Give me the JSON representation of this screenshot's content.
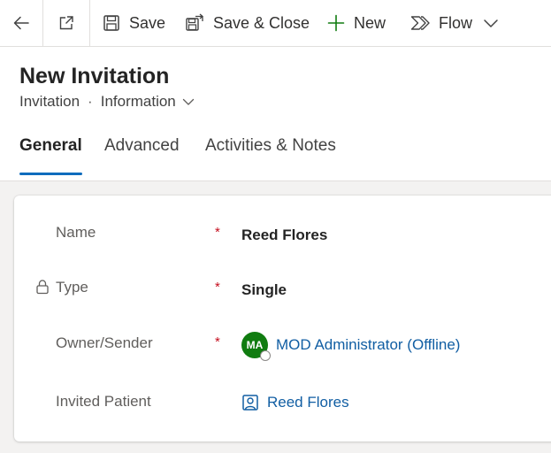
{
  "toolbar": {
    "save_label": "Save",
    "save_close_label": "Save & Close",
    "new_label": "New",
    "flow_label": "Flow"
  },
  "header": {
    "title": "New Invitation",
    "entity": "Invitation",
    "separator": "·",
    "form_name": "Information"
  },
  "tabs": [
    {
      "label": "General",
      "active": true
    },
    {
      "label": "Advanced",
      "active": false
    },
    {
      "label": "Activities & Notes",
      "active": false
    }
  ],
  "fields": {
    "name": {
      "label": "Name",
      "required": "*",
      "value": "Reed Flores"
    },
    "type": {
      "label": "Type",
      "required": "*",
      "value": "Single"
    },
    "owner": {
      "label": "Owner/Sender",
      "required": "*",
      "initials": "MA",
      "value": "MOD Administrator (Offline)"
    },
    "invited_patient": {
      "label": "Invited Patient",
      "value": "Reed Flores"
    }
  },
  "colors": {
    "accent": "#0f6cbd",
    "link": "#115ea3",
    "required": "#c50f1f",
    "avatar": "#107c10",
    "new_icon": "#107c10"
  }
}
